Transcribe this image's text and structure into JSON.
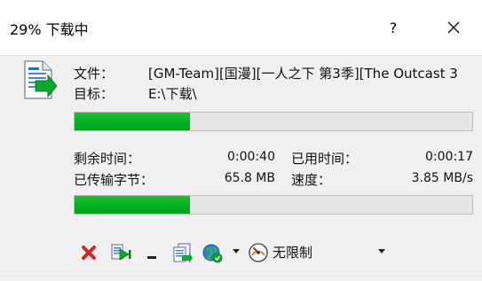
{
  "window": {
    "title": "29% 下载中",
    "help_label": "?"
  },
  "file": {
    "name_label": "文件：",
    "name_value": "[GM-Team][国漫][一人之下 第3季][The Outcast 3",
    "target_label": "目标：",
    "target_value": "E:\\下载\\"
  },
  "progress": {
    "file_fraction": 0.29,
    "overall_fraction": 0.29
  },
  "stats": {
    "remaining_label": "剩余时间：",
    "remaining_value": "0:00:40",
    "elapsed_label": "已用时间：",
    "elapsed_value": "0:00:17",
    "transferred_label": "已传输字节：",
    "transferred_value": "65.8 MB",
    "speed_label": "速度：",
    "speed_value": "3.85 MB/s"
  },
  "toolbar": {
    "speed_limit_label": "无限制",
    "icons": [
      "close-icon",
      "play-icon",
      "minimize-icon",
      "copy-icon",
      "browser-icon",
      "speedometer-icon"
    ]
  },
  "colors": {
    "progress_green": "#06b025",
    "cancel_red": "#d4232b"
  }
}
